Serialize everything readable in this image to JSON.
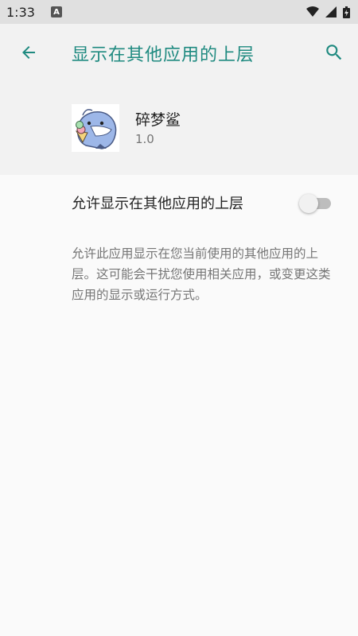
{
  "status_bar": {
    "time": "1:33",
    "notification_icon": "A"
  },
  "toolbar": {
    "title": "显示在其他应用的上层",
    "back_icon": "arrow-back-icon",
    "search_icon": "search-icon"
  },
  "app_info": {
    "name": "碎梦鲨",
    "version": "1.0"
  },
  "setting": {
    "label": "允许显示在其他应用的上层",
    "enabled": false
  },
  "description": "允许此应用显示在您当前使用的其他应用的上层。这可能会干扰您使用相关应用，或变更这类应用的显示或运行方式。",
  "colors": {
    "accent": "#1f8a80",
    "header_bg": "#f2f2f2",
    "page_bg": "#fafafa"
  }
}
